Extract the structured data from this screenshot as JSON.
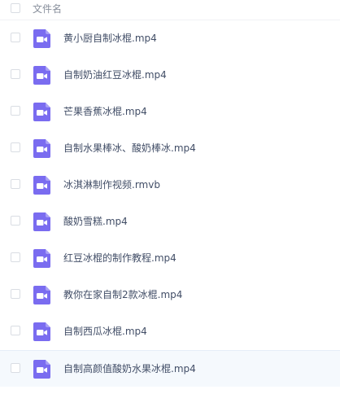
{
  "header": {
    "column_label": "文件名"
  },
  "colors": {
    "icon": "#7a6cf0",
    "text": "#424e67",
    "header_text": "#888f9c",
    "hover_row": "#f5f9fd"
  },
  "files": [
    {
      "name": "黄小厨自制冰棍.mp4",
      "icon": "video-file-icon"
    },
    {
      "name": "自制奶油红豆冰棍.mp4",
      "icon": "video-file-icon"
    },
    {
      "name": "芒果香蕉冰棍.mp4",
      "icon": "video-file-icon"
    },
    {
      "name": "自制水果棒冰、酸奶棒冰.mp4",
      "icon": "video-file-icon"
    },
    {
      "name": "冰淇淋制作视频.rmvb",
      "icon": "video-file-icon"
    },
    {
      "name": "酸奶雪糕.mp4",
      "icon": "video-file-icon"
    },
    {
      "name": "红豆冰棍的制作教程.mp4",
      "icon": "video-file-icon"
    },
    {
      "name": "教你在家自制2款冰棍.mp4",
      "icon": "video-file-icon"
    },
    {
      "name": "自制西瓜冰棍.mp4",
      "icon": "video-file-icon"
    },
    {
      "name": "自制高颜值酸奶水果冰棍.mp4",
      "icon": "video-file-icon"
    }
  ]
}
